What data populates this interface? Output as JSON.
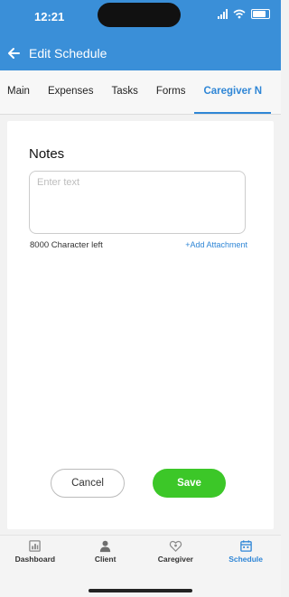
{
  "status_bar": {
    "time": "12:21"
  },
  "header": {
    "title": "Edit Schedule"
  },
  "tabs": [
    {
      "label": "Main",
      "active": false
    },
    {
      "label": "Expenses",
      "active": false
    },
    {
      "label": "Tasks",
      "active": false
    },
    {
      "label": "Forms",
      "active": false
    },
    {
      "label": "Caregiver N",
      "active": true
    }
  ],
  "notes": {
    "title": "Notes",
    "placeholder": "Enter text",
    "value": "",
    "char_left": "8000 Character left",
    "add_attachment": "+Add Attachment"
  },
  "actions": {
    "cancel_label": "Cancel",
    "save_label": "Save"
  },
  "bottom_nav": [
    {
      "label": "Dashboard",
      "icon": "dashboard-icon",
      "active": false
    },
    {
      "label": "Client",
      "icon": "client-icon",
      "active": false
    },
    {
      "label": "Caregiver",
      "icon": "caregiver-icon",
      "active": false
    },
    {
      "label": "Schedule",
      "icon": "schedule-icon",
      "active": true
    }
  ],
  "colors": {
    "primary": "#3a8fd8",
    "accent": "#2f86d6",
    "save": "#3cc728"
  }
}
